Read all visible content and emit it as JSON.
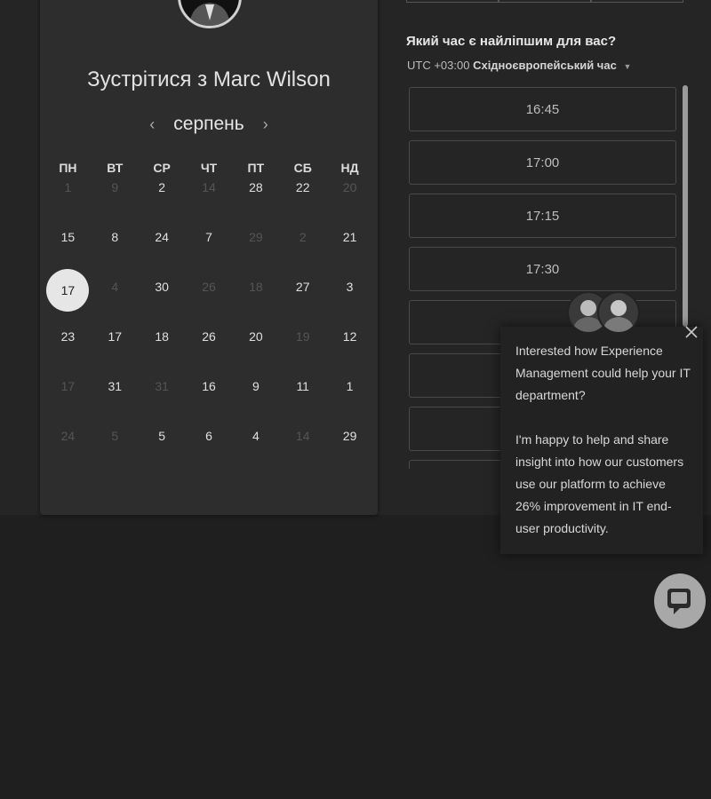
{
  "host": {
    "title_prefix": "Зустрітися з",
    "name": "Marc Wilson"
  },
  "calendar": {
    "month": "серпень",
    "prev_icon": "chevron-left-icon",
    "next_icon": "chevron-right-icon",
    "weekdays": [
      "ПН",
      "ВТ",
      "СР",
      "ЧТ",
      "ПТ",
      "СБ",
      "НД"
    ],
    "weeks": [
      [
        {
          "d": "1",
          "m": true
        },
        {
          "d": "9",
          "m": true
        },
        {
          "d": "2"
        },
        {
          "d": "14",
          "m": true
        },
        {
          "d": "28"
        },
        {
          "d": "22"
        },
        {
          "d": "20",
          "m": true
        }
      ],
      [
        {
          "d": "15"
        },
        {
          "d": "8"
        },
        {
          "d": "24"
        },
        {
          "d": "7"
        },
        {
          "d": "29",
          "m": true
        },
        {
          "d": "2",
          "m": true
        },
        {
          "d": "21"
        }
      ],
      [
        {
          "d": "17",
          "s": true
        },
        {
          "d": "4",
          "m": true
        },
        {
          "d": "30"
        },
        {
          "d": "26",
          "m": true
        },
        {
          "d": "18",
          "m": true
        },
        {
          "d": "27"
        },
        {
          "d": "3"
        }
      ],
      [
        {
          "d": "23"
        },
        {
          "d": "17"
        },
        {
          "d": "18"
        },
        {
          "d": "26"
        },
        {
          "d": "20"
        },
        {
          "d": "19",
          "m": true
        },
        {
          "d": "12"
        }
      ],
      [
        {
          "d": "17",
          "m": true
        },
        {
          "d": "31"
        },
        {
          "d": "31",
          "m": true
        },
        {
          "d": "16"
        },
        {
          "d": "9"
        },
        {
          "d": "11"
        },
        {
          "d": "1"
        }
      ],
      [
        {
          "d": "24",
          "m": true
        },
        {
          "d": "5",
          "m": true
        },
        {
          "d": "5"
        },
        {
          "d": "6"
        },
        {
          "d": "4"
        },
        {
          "d": "14",
          "m": true
        },
        {
          "d": "29"
        }
      ]
    ]
  },
  "times": {
    "question": "Який час є найліпшим для вас?",
    "tz_offset": "UTC +03:00",
    "tz_name": "Східноєвропейський час",
    "slots": [
      "16:45",
      "17:00",
      "17:15",
      "17:30",
      "",
      "",
      "",
      ""
    ]
  },
  "chat": {
    "paragraph1": "Interested how Experience Management could help your IT department?",
    "paragraph2": "I'm happy to help and share insight into how our customers use our platform to achieve 26% improvement in IT end-user productivity.",
    "close_icon": "close-icon",
    "launcher_icon": "chat-bubble-icon"
  }
}
